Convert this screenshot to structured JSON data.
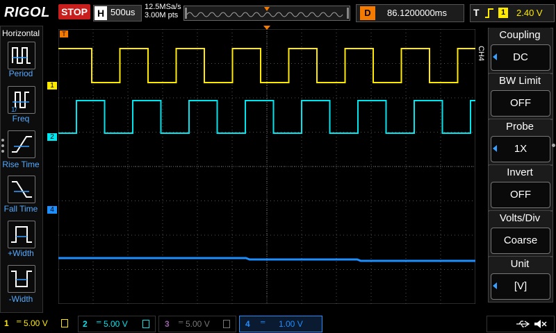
{
  "top": {
    "logo": "RIGOL",
    "run_state": "STOP",
    "h_key": "H",
    "timebase": "500us",
    "sample_rate": "12.5MSa/s",
    "memory_depth": "3.00M pts",
    "delay_key": "D",
    "delay_value": "86.1200000ms",
    "trig_key": "T",
    "trig_channel": "1",
    "trig_level": "2.40 V"
  },
  "left": {
    "title": "Horizontal",
    "items": [
      {
        "label": "Period",
        "icon": "period-icon"
      },
      {
        "label": "Freq",
        "icon": "freq-icon"
      },
      {
        "label": "Rise Time",
        "icon": "rise-time-icon"
      },
      {
        "label": "Fall Time",
        "icon": "fall-time-icon"
      },
      {
        "label": "+Width",
        "icon": "positive-width-icon"
      },
      {
        "label": "-Width",
        "icon": "negative-width-icon"
      }
    ]
  },
  "right": {
    "tab": "CH4",
    "items": [
      {
        "caption": "Coupling",
        "value": "DC",
        "arrow": true
      },
      {
        "caption": "BW Limit",
        "value": "OFF",
        "arrow": false
      },
      {
        "caption": "Probe",
        "value": "1X",
        "arrow": true
      },
      {
        "caption": "Invert",
        "value": "OFF",
        "arrow": false
      },
      {
        "caption": "Volts/Div",
        "value": "Coarse",
        "arrow": false
      },
      {
        "caption": "Unit",
        "value": "[V]",
        "arrow": true
      }
    ]
  },
  "markers": {
    "ch1": "1",
    "ch2": "2",
    "ch4": "4",
    "trigger": "T"
  },
  "bottom": {
    "channels": [
      {
        "num": "1",
        "scale": "5.00 V",
        "color": "#ffea00"
      },
      {
        "num": "2",
        "scale": "5.00 V",
        "color": "#00e5ee"
      },
      {
        "num": "3",
        "scale": "5.00 V",
        "color": "#9b5fa8"
      },
      {
        "num": "4",
        "scale": "1.00 V",
        "color": "#1e8fff"
      }
    ]
  },
  "colors": {
    "ch1": "#ffea00",
    "ch2": "#00e5ee",
    "ch4": "#1e8fff",
    "accent": "#f57b00",
    "stop": "#c81e1e"
  }
}
